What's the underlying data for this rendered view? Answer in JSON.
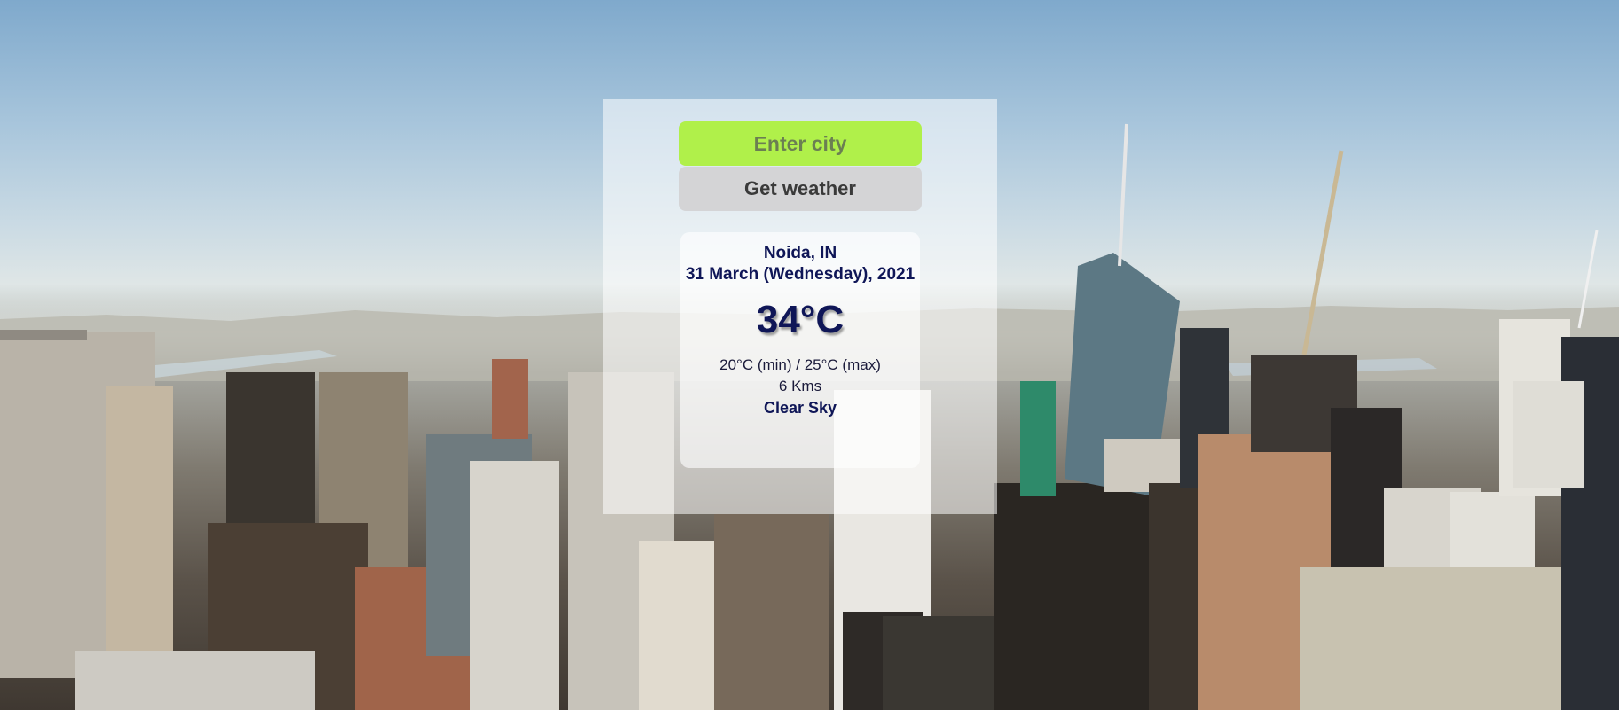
{
  "search": {
    "placeholder": "Enter city",
    "button_label": "Get weather"
  },
  "weather": {
    "location": "Noida, IN",
    "date": "31 March (Wednesday), 2021",
    "temperature": "34°C",
    "min_max": "20°C (min) / 25°C (max)",
    "visibility": "6 Kms",
    "description": "Clear Sky"
  },
  "colors": {
    "input_bg": "#b0f04a",
    "button_bg": "#d4d4d6",
    "text_primary": "#0f1657"
  }
}
